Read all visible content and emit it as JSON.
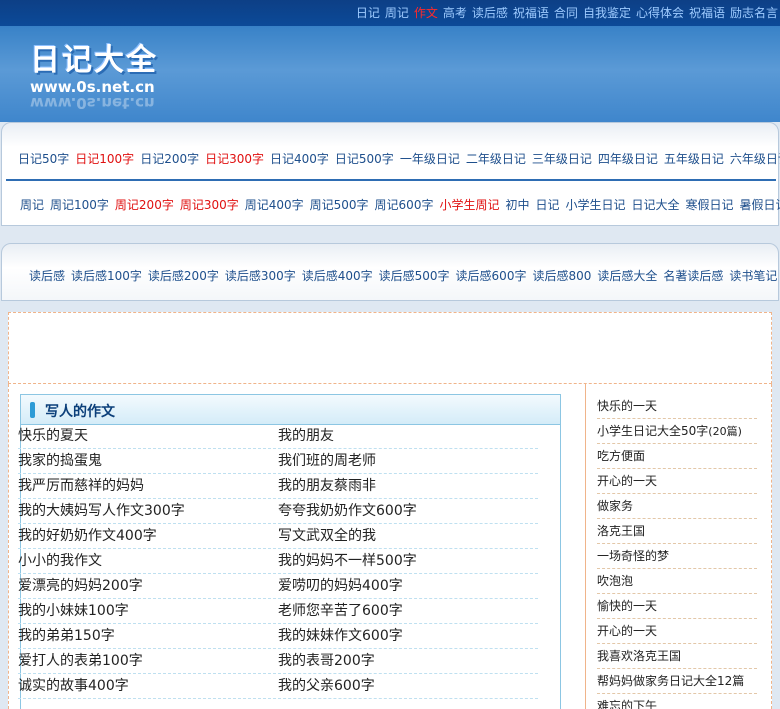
{
  "top_nav": [
    {
      "label": "日记",
      "highlight": false
    },
    {
      "label": "周记",
      "highlight": false
    },
    {
      "label": "作文",
      "highlight": true
    },
    {
      "label": "高考",
      "highlight": false
    },
    {
      "label": "读后感",
      "highlight": false
    },
    {
      "label": "祝福语",
      "highlight": false
    },
    {
      "label": "合同",
      "highlight": false
    },
    {
      "label": "自我鉴定",
      "highlight": false
    },
    {
      "label": "心得体会",
      "highlight": false
    },
    {
      "label": "祝福语",
      "highlight": false
    },
    {
      "label": "励志名言",
      "highlight": false
    }
  ],
  "logo": {
    "title": "日记大全",
    "url": "www.0s.net.cn"
  },
  "nav_row1": [
    {
      "label": "日记50字",
      "highlight": false
    },
    {
      "label": "日记100字",
      "highlight": true
    },
    {
      "label": "日记200字",
      "highlight": false
    },
    {
      "label": "日记300字",
      "highlight": true
    },
    {
      "label": "日记400字",
      "highlight": false
    },
    {
      "label": "日记500字",
      "highlight": false
    },
    {
      "label": "一年级日记",
      "highlight": false
    },
    {
      "label": "二年级日记",
      "highlight": false
    },
    {
      "label": "三年级日记",
      "highlight": false
    },
    {
      "label": "四年级日记",
      "highlight": false
    },
    {
      "label": "五年级日记",
      "highlight": false
    },
    {
      "label": "六年级日记",
      "highlight": false
    }
  ],
  "nav_row2": [
    {
      "label": "周记",
      "highlight": false
    },
    {
      "label": "周记100字",
      "highlight": false
    },
    {
      "label": "周记200字",
      "highlight": true
    },
    {
      "label": "周记300字",
      "highlight": true
    },
    {
      "label": "周记400字",
      "highlight": false
    },
    {
      "label": "周记500字",
      "highlight": false
    },
    {
      "label": "周记600字",
      "highlight": false
    },
    {
      "label": "小学生周记",
      "highlight": true
    },
    {
      "label": "初中",
      "highlight": false
    },
    {
      "label": "日记",
      "highlight": false
    },
    {
      "label": "小学生日记",
      "highlight": false
    },
    {
      "label": "日记大全",
      "highlight": false
    },
    {
      "label": "寒假日记",
      "highlight": false
    },
    {
      "label": "暑假日记",
      "highlight": false
    }
  ],
  "nav_row3": [
    {
      "label": "读后感",
      "highlight": false
    },
    {
      "label": "读后感100字",
      "highlight": false
    },
    {
      "label": "读后感200字",
      "highlight": false
    },
    {
      "label": "读后感300字",
      "highlight": false
    },
    {
      "label": "读后感400字",
      "highlight": false
    },
    {
      "label": "读后感500字",
      "highlight": false
    },
    {
      "label": "读后感600字",
      "highlight": false
    },
    {
      "label": "读后感800",
      "highlight": false
    },
    {
      "label": "读后感大全",
      "highlight": false
    },
    {
      "label": "名著读后感",
      "highlight": false
    },
    {
      "label": "读书笔记",
      "highlight": false
    }
  ],
  "section": {
    "title": "写人的作文",
    "left_items": [
      "快乐的夏天",
      "我家的捣蛋鬼",
      "我严厉而慈祥的妈妈",
      "我的大姨妈写人作文300字",
      "我的好奶奶作文400字",
      "小小的我作文",
      "爱漂亮的妈妈200字",
      "我的小妹妹100字",
      "我的弟弟150字",
      "爱打人的表弟100字",
      "诚实的故事400字"
    ],
    "right_items": [
      "我的朋友",
      "我们班的周老师",
      "我的朋友蔡雨非",
      "夸夸我奶奶作文600字",
      "写文武双全的我",
      "我的妈妈不一样500字",
      "爱唠叨的妈妈400字",
      "老师您辛苦了600字",
      "我的妹妹作文600字",
      "我的表哥200字",
      "我的父亲600字"
    ]
  },
  "sidebar": [
    {
      "label": "快乐的一天",
      "note": ""
    },
    {
      "label": "小学生日记大全50字",
      "note": "(20篇)"
    },
    {
      "label": "吃方便面",
      "note": ""
    },
    {
      "label": "开心的一天",
      "note": ""
    },
    {
      "label": "做家务",
      "note": ""
    },
    {
      "label": "洛克王国",
      "note": ""
    },
    {
      "label": "一场奇怪的梦",
      "note": ""
    },
    {
      "label": "吹泡泡",
      "note": ""
    },
    {
      "label": "愉快的一天",
      "note": ""
    },
    {
      "label": "开心的一天",
      "note": ""
    },
    {
      "label": "我喜欢洛克王国",
      "note": ""
    },
    {
      "label": "帮妈妈做家务日记大全12篇",
      "note": ""
    },
    {
      "label": "难忘的下午",
      "note": ""
    }
  ],
  "colors": {
    "link": "#1e4f8c",
    "highlight": "#e01010",
    "header_blue": "#3f86cc"
  }
}
